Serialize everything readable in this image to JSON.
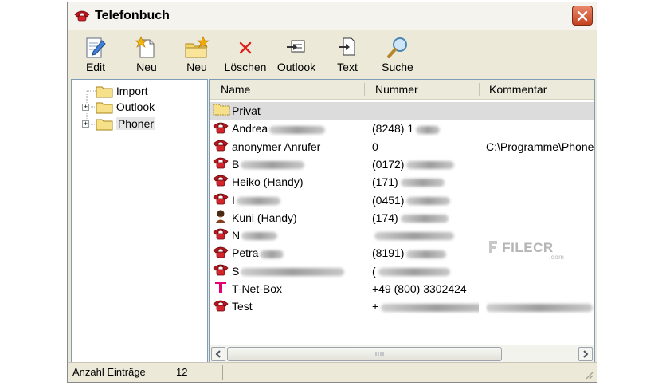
{
  "window": {
    "title": "Telefonbuch"
  },
  "toolbar": {
    "edit": "Edit",
    "neu1": "Neu",
    "neu2": "Neu",
    "loeschen": "Löschen",
    "outlook": "Outlook",
    "text": "Text",
    "suche": "Suche"
  },
  "tree": {
    "items": [
      {
        "label": "Import",
        "expandable": false
      },
      {
        "label": "Outlook",
        "expandable": true
      },
      {
        "label": "Phoner",
        "expandable": true,
        "selected": true
      }
    ]
  },
  "list": {
    "columns": [
      "Name",
      "Nummer",
      "Kommentar"
    ],
    "rows": [
      {
        "icon": "folder-icon",
        "name": "Privat",
        "nummer": "",
        "kommentar": "",
        "selected": true
      },
      {
        "icon": "phone-icon",
        "name": "Andrea",
        "nummer": "(8248) 1",
        "kommentar": ""
      },
      {
        "icon": "phone-icon",
        "name": "anonymer Anrufer",
        "nummer": "0",
        "kommentar": "C:\\Programme\\Phone"
      },
      {
        "icon": "phone-icon",
        "name": "B",
        "nummer": "(0172)",
        "kommentar": ""
      },
      {
        "icon": "phone-icon",
        "name": "Heiko (Handy)",
        "nummer": "(171)",
        "kommentar": ""
      },
      {
        "icon": "phone-icon",
        "name": "I",
        "nummer": "(0451)",
        "kommentar": ""
      },
      {
        "icon": "person-icon",
        "name": "Kuni (Handy)",
        "nummer": "(174)",
        "kommentar": ""
      },
      {
        "icon": "phone-icon",
        "name": "N",
        "nummer": "",
        "kommentar": ""
      },
      {
        "icon": "phone-icon",
        "name": "Petra",
        "nummer": "(8191)",
        "kommentar": ""
      },
      {
        "icon": "phone-icon",
        "name": "S",
        "nummer": "(",
        "kommentar": ""
      },
      {
        "icon": "telekom-icon",
        "name": "T-Net-Box",
        "nummer": "+49 (800) 3302424",
        "kommentar": ""
      },
      {
        "icon": "phone-icon",
        "name": "Test",
        "nummer": "+",
        "kommentar": ""
      }
    ]
  },
  "status": {
    "label": "Anzahl Einträge",
    "count": "12"
  },
  "watermark": {
    "brand": "FILECR",
    "suffix": ".com"
  },
  "colors": {
    "phone_red": "#c0141c",
    "folder_yellow": "#f7e08a",
    "selection": "#dcdcdc",
    "telekom": "#e20074"
  }
}
